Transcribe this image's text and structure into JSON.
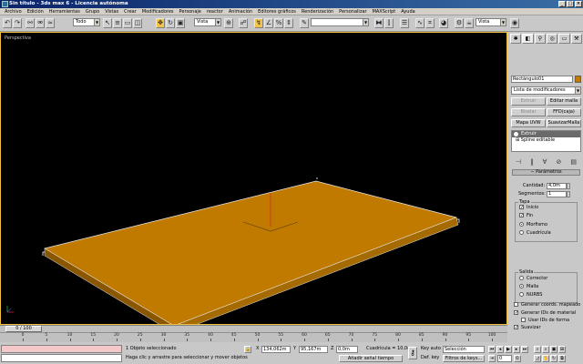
{
  "window": {
    "title": "Sin título - 3ds max 6 - Licencia autónoma"
  },
  "menu": [
    "Archivo",
    "Edición",
    "Herramientas",
    "Grupo",
    "Vistas",
    "Crear",
    "Modificadores",
    "Personaje",
    "reactor",
    "Animación",
    "Editores gráficos",
    "Renderización",
    "Personalizar",
    "MAXScript",
    "Ayuda"
  ],
  "toolbar": {
    "selection_filter": "Todo",
    "ref_coord": "Vista",
    "named_selection": ""
  },
  "viewport": {
    "label": "Perspectiva"
  },
  "colors": {
    "object": "#c07a00",
    "viewport_border": "#f0c040"
  },
  "command_panel": {
    "object_name": "Rectángulo01",
    "modifier_list": "Lista de modificadores",
    "buttons": {
      "extruir": "Extruir",
      "editar_malla": "Editar malla",
      "biselar": "Biselar",
      "ffd": "FFD(caja)",
      "mapa_uvw": "Mapa UVW",
      "suavizar_malla": "SuavizarMalla"
    },
    "stack": [
      "Extruir",
      "Spline editable"
    ],
    "rollout_title": "Parámetros",
    "cantidad_label": "Cantidad:",
    "cantidad_value": "4,0m",
    "segmentos_label": "Segmentos:",
    "segmentos_value": "1",
    "tapa_title": "Tapa",
    "inicio": "Inicio",
    "fin": "Fin",
    "morfismo": "Morfismo",
    "cuadricula": "Cuadrícula",
    "salida_title": "Salida",
    "corrector": "Corrector",
    "malla": "Malla",
    "nurbs": "NURBS",
    "gen_coords": "Generar coords. mapeado",
    "gen_ids": "Generar IDs de material",
    "usar_ids": "Usar IDs de forma",
    "suavizar": "Suavizar"
  },
  "timeline": {
    "frame_display": "0 / 100",
    "ticks": [
      "0",
      "5",
      "10",
      "15",
      "20",
      "25",
      "30",
      "35",
      "40",
      "45",
      "50",
      "55",
      "60",
      "65",
      "70",
      "75",
      "80",
      "85",
      "90",
      "95",
      "100"
    ]
  },
  "status": {
    "selected": "1 Objeto seleccionado",
    "prompt": "Haga clic y arrastre para seleccionar y mover objetos",
    "x_label": "X",
    "x_value": "134,062m",
    "y_label": "Y",
    "y_value": "95,167m",
    "z_label": "Z",
    "z_value": "0,0m",
    "grid": "Cuadrícula = 10,0m",
    "add_time_tag": "Añadir señal tiempo",
    "key_auto": "Key auto",
    "key_mode": "Selección",
    "def_key": "Def. key",
    "key_filters": "Filtros de keys...",
    "frame": "0"
  }
}
